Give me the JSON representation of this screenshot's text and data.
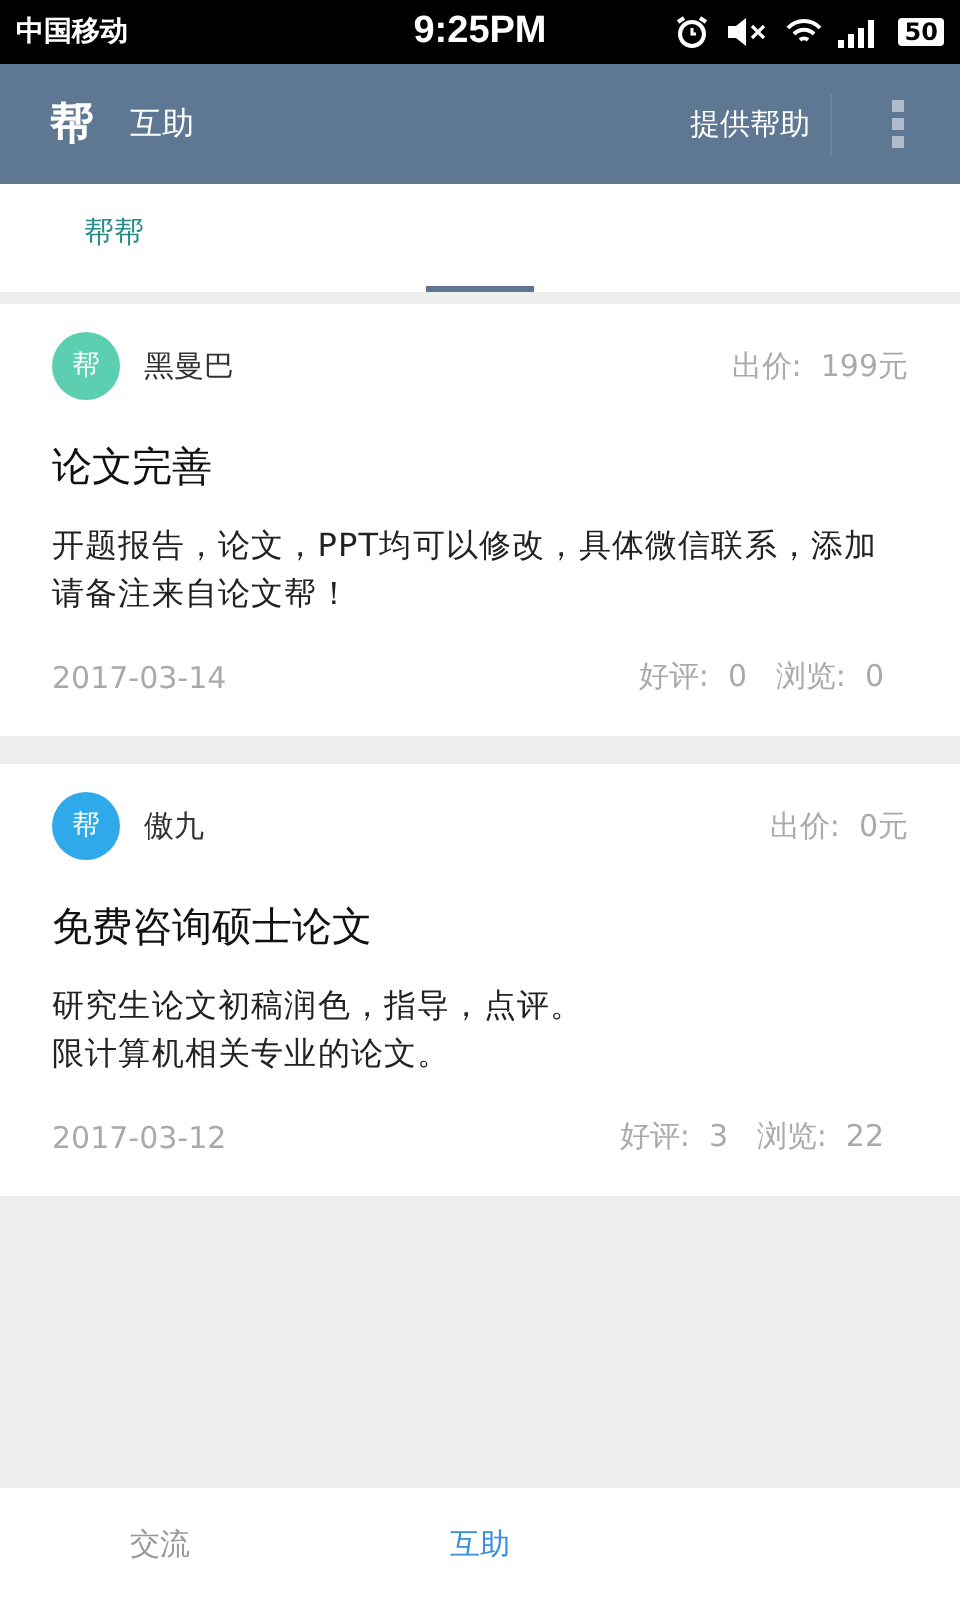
{
  "status_bar": {
    "carrier": "中国移动",
    "time": "9:25PM",
    "battery": "50"
  },
  "app_bar": {
    "logo": "帮",
    "title": "互助",
    "action": "提供帮助"
  },
  "tabs": [
    {
      "label": "帮帮",
      "selected": true
    }
  ],
  "posts": [
    {
      "avatar": "帮",
      "color": "#5ccfb0",
      "user": "黑曼巴",
      "price_label": "出价:",
      "price": "199元",
      "title": "论文完善",
      "body": [
        "开题报告，论文，PPT均可以修改，具体微信联系，添加请备注来自论文帮！"
      ],
      "date": "2017-03-14",
      "likes_label": "好评:",
      "likes": "0",
      "views_label": "浏览:",
      "views": "0"
    },
    {
      "avatar": "帮",
      "color": "#2fa9ea",
      "user": "傲九",
      "price_label": "出价:",
      "price": "0元",
      "title": "免费咨询硕士论文",
      "body": [
        "研究生论文初稿润色，指导，点评。",
        "限计算机相关专业的论文。"
      ],
      "date": "2017-03-12",
      "likes_label": "好评:",
      "likes": "3",
      "views_label": "浏览:",
      "views": "22"
    }
  ],
  "bottom_nav": [
    {
      "label": "交流",
      "selected": false
    },
    {
      "label": "互助",
      "selected": true
    }
  ]
}
